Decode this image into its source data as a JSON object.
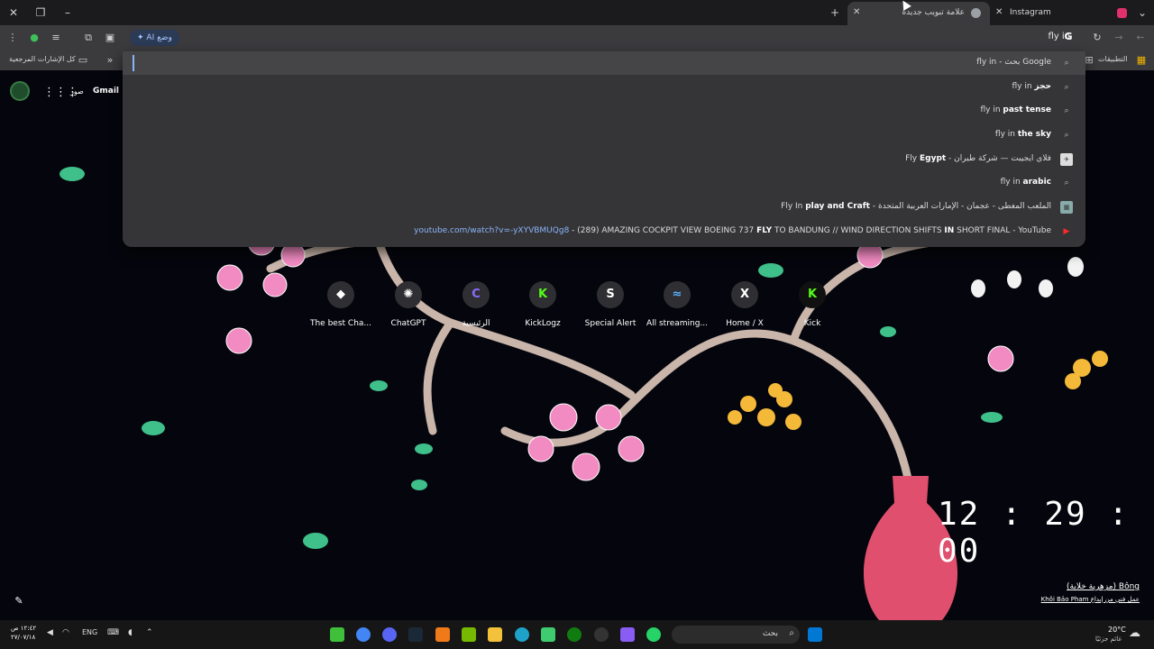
{
  "tabs": [
    {
      "title": "Instagram"
    },
    {
      "title": "علامة تبويب جديدة"
    }
  ],
  "toolbar": {
    "ai_mode": "وضع AI",
    "omnibox_value": "fly in"
  },
  "bookmarks": {
    "all_bookmarks": "كل الإشارات المرجعية",
    "apps": "التطبيقات"
  },
  "suggestions": [
    {
      "pre": "fly in",
      "bold": "",
      "post": " - بحث Google"
    },
    {
      "pre": "fly in ",
      "bold": "حجز",
      "post": ""
    },
    {
      "pre": "fly in ",
      "bold": "past tense",
      "post": ""
    },
    {
      "pre": "fly in ",
      "bold": "the sky",
      "post": ""
    },
    {
      "pre": "Fly ",
      "bold": "Egypt",
      "post": " - فلاي ايجيبت — شركة طيران"
    },
    {
      "pre": "fly in ",
      "bold": "arabic",
      "post": ""
    },
    {
      "pre": "Fly In ",
      "bold": "play and Craft",
      "post": " - الملعب المغطى - عجمان - الإمارات العربية المتحدة"
    },
    {
      "link": "youtube.com/watch?v=-yXYVBMUQg8",
      "text_a": " - (289) AMAZING COCKPIT VIEW BOEING 737 ",
      "bold1": "FLY",
      "text_b": " TO BANDUNG // WIND DIRECTION SHIFTS ",
      "bold2": "IN",
      "text_c": " SHORT FINAL - YouTube"
    }
  ],
  "ntp": {
    "gmail": "Gmail",
    "images": "صور"
  },
  "shortcuts": [
    {
      "label": "The best Cha...",
      "glyph": "◆"
    },
    {
      "label": "ChatGPT",
      "glyph": "✺"
    },
    {
      "label": "الرئيسية",
      "glyph": "C"
    },
    {
      "label": "KickLogz",
      "glyph": "K"
    },
    {
      "label": "Special Alert",
      "glyph": "S"
    },
    {
      "label": "All streaming...",
      "glyph": "≈"
    },
    {
      "label": "Home / X",
      "glyph": "X"
    },
    {
      "label": "Kick",
      "glyph": "K"
    }
  ],
  "clock": "12 : 29 : 00",
  "credit": {
    "title": "Bông (مزهرية خلابة)",
    "author": "عمل فني من إبداع Khôi Bảo Pham"
  },
  "taskbar": {
    "time": "١٢:٤٢ ص",
    "date": "٢٧/٠٧/١٨",
    "lang": "ENG",
    "search": "بحث",
    "temp": "20°C",
    "weather": "غائم جزئيًا"
  },
  "colors": {
    "accent": "#8ab4f8",
    "dropdown": "#353537",
    "chrome": "#3b3b3e",
    "youtube": "#ff2a2a"
  }
}
